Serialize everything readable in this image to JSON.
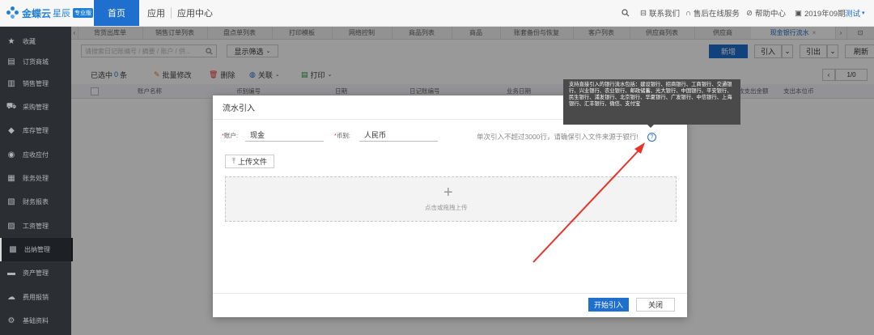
{
  "topbar": {
    "logo_text": "金蝶云",
    "logo_sub": "星辰",
    "logo_badge": "专业版",
    "nav": [
      "首页",
      "应用",
      "应用中心"
    ],
    "right": {
      "contact": "联系我们",
      "service": "售后在线服务",
      "help": "帮助中心",
      "period": "2019年09期",
      "user": "测试"
    }
  },
  "sidebar": {
    "items": [
      {
        "label": "收藏",
        "icon": "star-icon"
      },
      {
        "label": "订货商城",
        "icon": "store-icon"
      },
      {
        "label": "销售管理",
        "icon": "chart-icon"
      },
      {
        "label": "采购管理",
        "icon": "cart-icon"
      },
      {
        "label": "库存管理",
        "icon": "box-icon"
      },
      {
        "label": "应收应付",
        "icon": "money-icon"
      },
      {
        "label": "账务处理",
        "icon": "ledger-icon"
      },
      {
        "label": "财务报表",
        "icon": "report-icon"
      },
      {
        "label": "工资管理",
        "icon": "salary-icon"
      },
      {
        "label": "出纳管理",
        "icon": "cashier-icon"
      },
      {
        "label": "资产管理",
        "icon": "asset-icon"
      },
      {
        "label": "费用报销",
        "icon": "expense-icon"
      },
      {
        "label": "基础资料",
        "icon": "settings-icon"
      }
    ]
  },
  "tabs": [
    "背货出库单",
    "销售订单列表",
    "盘点单列表",
    "打印模板",
    "网络控制",
    "商品列表",
    "商品",
    "账套备份与恢复",
    "客户列表",
    "供应商列表",
    "供应商",
    "现金银行流水"
  ],
  "toolbar": {
    "search_placeholder": "请搜索日记账编号 / 摘要 / 账户 / 供...",
    "filter_label": "显示筛选",
    "new_label": "新增",
    "import_label": "引入",
    "export_label": "引出",
    "refresh_label": "刷新",
    "selected_prefix": "已选中",
    "selected_count": "0",
    "selected_suffix": "条",
    "batch_edit": "批量修改",
    "delete": "删除",
    "link": "关联",
    "print": "打印",
    "pager": "1/0"
  },
  "table": {
    "headers": [
      "账户名称",
      "币别编号",
      "日期",
      "日记账编号",
      "业务日期",
      "收支出金额",
      "支出本位币"
    ]
  },
  "dialog": {
    "title": "流水引入",
    "account_label": "账户:",
    "account_value": "现金",
    "currency_label": "币别:",
    "currency_value": "人民币",
    "hint": "单次引入不超过3000行，请确保引入文件来源于银行!",
    "upload_label": "上传文件",
    "drop_text": "点击或拖拽上传",
    "start_label": "开始引入",
    "close_label": "关闭"
  },
  "tooltip": {
    "text": "支持直接引入的银行流水包括：建设银行、招商银行、工商银行、交通银行、兴业银行、农业银行、邮政储蓄、光大银行、中国银行、平安银行、民生银行、浦发银行、北京银行、华夏银行、广发银行、中信银行、上海银行、汇丰银行、微信、支付宝"
  },
  "annotation": {
    "arrow_color": "#e8322b"
  }
}
